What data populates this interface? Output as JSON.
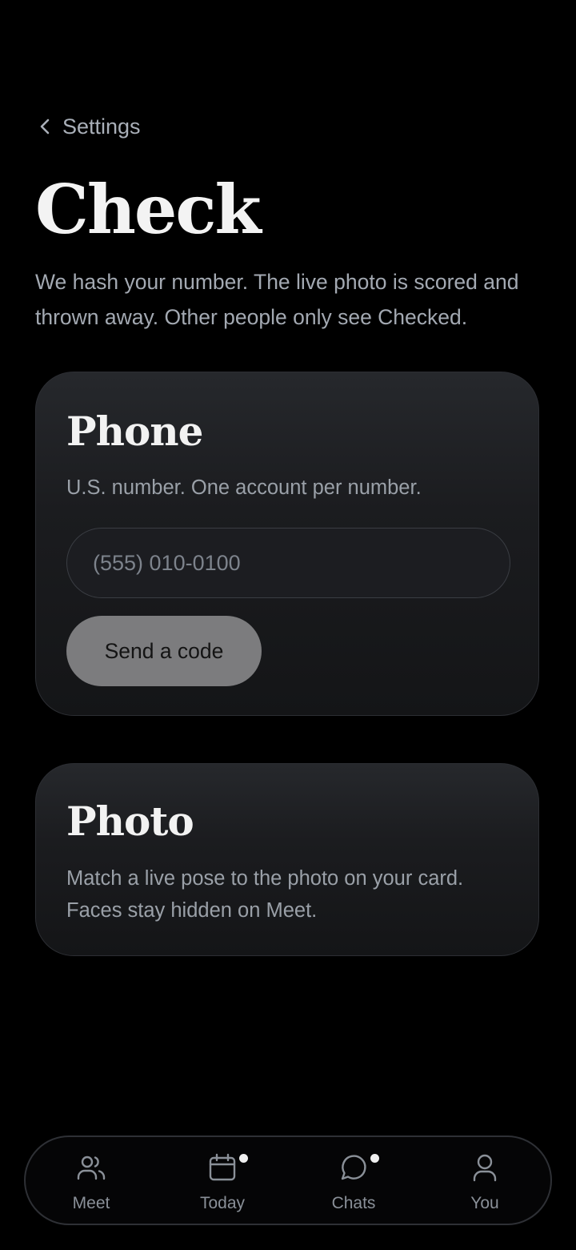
{
  "nav": {
    "back_label": "Settings"
  },
  "page": {
    "title": "Check",
    "intro": "We hash your number. The live photo is scored and thrown away. Other people only see Checked."
  },
  "phone_card": {
    "title": "Phone",
    "description": "U.S. number. One account per number.",
    "input_value": "",
    "input_placeholder": "(555) 010-0100",
    "button_label": "Send a code"
  },
  "photo_card": {
    "title": "Photo",
    "description": "Match a live pose to the photo on your card. Faces stay hidden on Meet."
  },
  "tabbar": {
    "tabs": [
      {
        "label": "Meet",
        "icon": "people-icon",
        "has_dot": false
      },
      {
        "label": "Today",
        "icon": "calendar-icon",
        "has_dot": true
      },
      {
        "label": "Chats",
        "icon": "chat-bubble-icon",
        "has_dot": true
      },
      {
        "label": "You",
        "icon": "person-icon",
        "has_dot": false
      }
    ]
  },
  "colors": {
    "background": "#000000",
    "card_top": "#26282c",
    "card_bottom": "#141517",
    "button": "#7c7c7e",
    "muted_text": "#a3a9b2"
  }
}
